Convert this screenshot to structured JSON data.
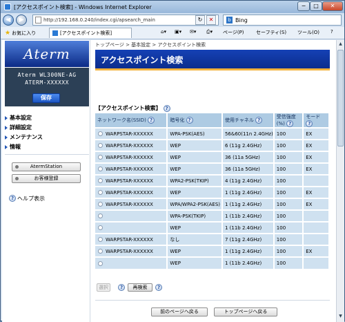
{
  "window": {
    "title": "[アクセスポイント検索] - Windows Internet Explorer",
    "min": "−",
    "max": "□",
    "close": "✕"
  },
  "browser": {
    "back": "◀",
    "forward": "▶",
    "url": "http://192.168.0.240/index.cgi/apsearch_main",
    "search_engine": "Bing",
    "favorites_label": "お気に入り",
    "tab_label": "[アクセスポイント検索]",
    "commands": {
      "page": "ページ(P)",
      "safety": "セーフティ(S)",
      "tools": "ツール(O)",
      "help": "?"
    }
  },
  "sidebar": {
    "logo": "Aterm",
    "device_model": "Aterm WL300NE-AG",
    "device_name": "ATERM-XXXXXX",
    "save_label": "保存",
    "menu": [
      "基本設定",
      "詳細設定",
      "メンテナンス",
      "情報"
    ],
    "buttons": [
      "AtermStation",
      "お客様登録"
    ],
    "help_label": "ヘルプ表示"
  },
  "main": {
    "breadcrumb": "トップページ > 基本設定 > アクセスポイント検索",
    "title": "アクセスポイント検索",
    "section_title": "【アクセスポイント検索】",
    "help_mark": "?",
    "columns": [
      "ネットワーク名(SSID)",
      "暗号化",
      "使用チャネル",
      "受信強度(%)",
      "モード"
    ],
    "rows": [
      {
        "ssid": "WARPSTAR-XXXXXX",
        "enc": "WPA-PSK(AES)",
        "ch": "56&60(11n 2.4GHz)",
        "sig": "100",
        "mode": "EX"
      },
      {
        "ssid": "WARPSTAR-XXXXXX",
        "enc": "WEP",
        "ch": "6 (11g 2.4GHz)",
        "sig": "100",
        "mode": "EX"
      },
      {
        "ssid": "WARPSTAR-XXXXXX",
        "enc": "WEP",
        "ch": "36 (11a 5GHz)",
        "sig": "100",
        "mode": "EX"
      },
      {
        "ssid": "WARPSTAR-XXXXXX",
        "enc": "WEP",
        "ch": "36 (11a 5GHz)",
        "sig": "100",
        "mode": "EX"
      },
      {
        "ssid": "WARPSTAR-XXXXXX",
        "enc": "WPA2-PSK(TKIP)",
        "ch": "4 (11g 2.4GHz)",
        "sig": "100",
        "mode": ""
      },
      {
        "ssid": "WARPSTAR-XXXXXX",
        "enc": "WEP",
        "ch": "1 (11g 2.4GHz)",
        "sig": "100",
        "mode": "EX"
      },
      {
        "ssid": "WARPSTAR-XXXXXX",
        "enc": "WPA/WPA2-PSK(AES)",
        "ch": "1 (11g 2.4GHz)",
        "sig": "100",
        "mode": "EX"
      },
      {
        "ssid": "",
        "enc": "WPA-PSK(TKIP)",
        "ch": "1 (11b 2.4GHz)",
        "sig": "100",
        "mode": ""
      },
      {
        "ssid": "",
        "enc": "WEP",
        "ch": "1 (11b 2.4GHz)",
        "sig": "100",
        "mode": ""
      },
      {
        "ssid": "WARPSTAR-XXXXXX",
        "enc": "なし",
        "ch": "7 (11g 2.4GHz)",
        "sig": "100",
        "mode": ""
      },
      {
        "ssid": "WARPSTAR-XXXXXX",
        "enc": "WEP",
        "ch": "1 (11g 2.4GHz)",
        "sig": "100",
        "mode": "EX"
      },
      {
        "ssid": "",
        "enc": "WEP",
        "ch": "1 (11b 2.4GHz)",
        "sig": "100",
        "mode": ""
      }
    ],
    "select_label": "選択",
    "rescan_label": "再検索",
    "back_label": "前のページへ戻る",
    "top_label": "トップページへ戻る"
  }
}
